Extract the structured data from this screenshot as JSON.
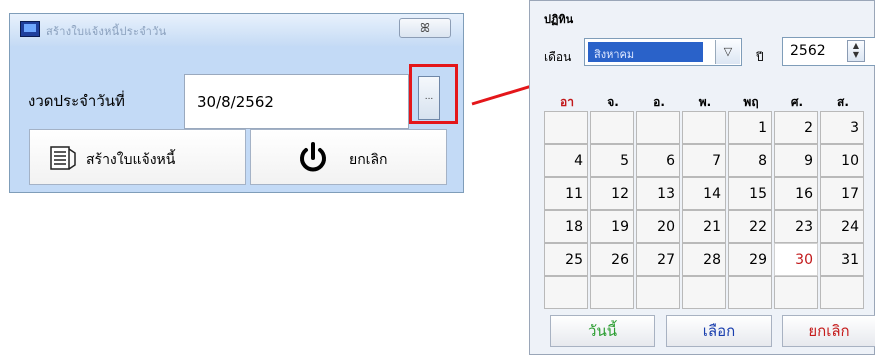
{
  "dialog": {
    "title": "สร้างใบแจ้งหนี้ประจำวัน",
    "close_label": "ꕤ",
    "date_label": "งวดประจำวันที่",
    "date_value": "30/8/2562",
    "browse_label": "...",
    "create_button_label": "สร้างใบแจ้งหนี้",
    "cancel_button_label": "ยกเลิก"
  },
  "calendar": {
    "title": "ปฏิทิน",
    "month_label": "เดือน",
    "month_value": "สิงหาคม",
    "month_dropdown_glyph": "▽",
    "year_label": "ปี",
    "year_value": "2562",
    "weekdays": [
      "อา",
      "จ.",
      "อ.",
      "พ.",
      "พฤ",
      "ศ.",
      "ส."
    ],
    "weekday_colors": [
      "#c2191b",
      "#000000",
      "#000000",
      "#000000",
      "#000000",
      "#000000",
      "#000000"
    ],
    "weeks": [
      [
        "",
        "",
        "",
        "",
        "1",
        "2",
        "3"
      ],
      [
        "4",
        "5",
        "6",
        "7",
        "8",
        "9",
        "10"
      ],
      [
        "11",
        "12",
        "13",
        "14",
        "15",
        "16",
        "17"
      ],
      [
        "18",
        "19",
        "20",
        "21",
        "22",
        "23",
        "24"
      ],
      [
        "25",
        "26",
        "27",
        "28",
        "29",
        "30",
        "31"
      ],
      [
        "",
        "",
        "",
        "",
        "",
        "",
        ""
      ]
    ],
    "selected_day": "30",
    "today_button_label": "วันนี้",
    "choose_button_label": "เลือก",
    "cancel_button_label": "ยกเลิก"
  },
  "colors": {
    "highlight_box": "#e4161a",
    "arrow": "#e4161a",
    "dialog_background": "#c3daf6",
    "selected_month_bg": "#2a62c9"
  }
}
